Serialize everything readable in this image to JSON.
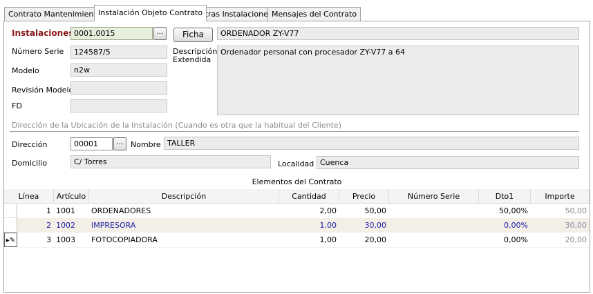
{
  "tabs": [
    {
      "label": "Contrato Mantenimiento"
    },
    {
      "label": "Instalación Objeto Contrato"
    },
    {
      "label": "Otras Instalaciones"
    },
    {
      "label": "Mensajes del Contrato"
    }
  ],
  "form": {
    "instalaciones_label": "Instalaciones",
    "instalaciones_value": "0001.0015",
    "lookup_button": "...",
    "ficha_button": "Ficha",
    "nombre_instalacion": "ORDENADOR ZY-V77",
    "numero_serie_label": "Número Serie",
    "numero_serie_value": "124587/5",
    "modelo_label": "Modelo",
    "modelo_value": "n2w",
    "revision_label": "Revisión Modelo",
    "revision_value": "",
    "fd_label": "FD",
    "fd_value": "",
    "descripcion_label_1": "Descripción",
    "descripcion_label_2": "Extendida",
    "descripcion_value": "Ordenador personal con procesador ZY-V77 a 64"
  },
  "ubicacion": {
    "section_title": "Dirección de la Ubicación de la Instalación (Cuando es otra que la habitual del Cliente)",
    "direccion_label": "Dirección",
    "direccion_value": "00001",
    "nombre_label": "Nombre",
    "nombre_value": "TALLER",
    "domicilio_label": "Domicilio",
    "domicilio_value": "C/ Torres",
    "localidad_label": "Localidad",
    "localidad_value": "Cuenca"
  },
  "grid": {
    "title": "Elementos del Contrato",
    "columns": {
      "linea": "Línea",
      "articulo": "Artículo",
      "descripcion": "Descripción",
      "cantidad": "Cantidad",
      "precio": "Precio",
      "numero_serie": "Número Serie",
      "dto1": "Dto1",
      "importe": "Importe"
    },
    "rows": [
      {
        "linea": "1",
        "articulo": "1001",
        "descripcion": "ORDENADORES",
        "cantidad": "2,00",
        "precio": "50,00",
        "numero_serie": "",
        "dto1": "50,00%",
        "importe": "50,00"
      },
      {
        "linea": "2",
        "articulo": "1002",
        "descripcion": "IMPRESORA",
        "cantidad": "1,00",
        "precio": "30,00",
        "numero_serie": "",
        "dto1": "0,00%",
        "importe": "30,00"
      },
      {
        "linea": "3",
        "articulo": "1003",
        "descripcion": "FOTOCOPIADORA",
        "cantidad": "1,00",
        "precio": "20,00",
        "numero_serie": "",
        "dto1": "0,00%",
        "importe": "20,00"
      }
    ],
    "edit_indicator": "▸✎"
  },
  "colors": {
    "required_label": "#8b1a1a",
    "selected_row_bg": "#f4efe6",
    "selected_row_text": "#1a1aa6"
  }
}
